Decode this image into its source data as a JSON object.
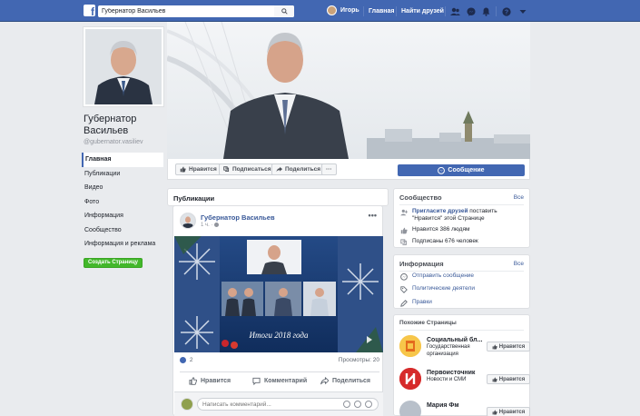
{
  "topbar": {
    "search_value": "Губернатор Васильев",
    "user_name": "Игорь",
    "home_link": "Главная",
    "find_friends_link": "Найти друзей"
  },
  "page": {
    "name": "Губернатор Васильев",
    "handle": "@gubernator.vasiliev"
  },
  "sidebar": {
    "items": [
      {
        "label": "Главная"
      },
      {
        "label": "Публикации"
      },
      {
        "label": "Видео"
      },
      {
        "label": "Фото"
      },
      {
        "label": "Информация"
      },
      {
        "label": "Сообщество"
      },
      {
        "label": "Информация и реклама"
      }
    ],
    "create_page_label": "Создать Страницу"
  },
  "actions": {
    "like_label": "Нравится",
    "follow_label": "Подписаться",
    "share_label": "Поделиться",
    "more_label": "···",
    "message_label": "Сообщение"
  },
  "publications": {
    "title": "Публикации",
    "post": {
      "author": "Губернатор Васильев",
      "time": "1 ч. ·",
      "more": "•••",
      "image_caption": "Итоги 2018 года",
      "likes_count": "2",
      "views": "Просмотры: 20",
      "like_label": "Нравится",
      "comment_label": "Комментарий",
      "share_label": "Поделиться",
      "comment_placeholder": "Написать комментарий..."
    }
  },
  "community": {
    "title": "Сообщество",
    "all_label": "Все",
    "invite_link": "Пригласите друзей",
    "invite_rest": " поставить \"Нравится\" этой Странице",
    "likes_text": "Нравится 386 людям",
    "followers_text": "Подписаны 676 человек"
  },
  "info": {
    "title": "Информация",
    "all_label": "Все",
    "send_message": "Отправить сообщение",
    "category": "Политические деятели",
    "edit": "Правки"
  },
  "similar": {
    "title": "Похожие Страницы",
    "items": [
      {
        "name": "Социальный бл...",
        "category": "Государственная организация",
        "button": "Нравится"
      },
      {
        "name": "Первоисточник",
        "category": "Новости и СМИ",
        "button": "Нравится"
      },
      {
        "name": "Мария Фм",
        "category": "",
        "button": "Нравится"
      }
    ]
  },
  "colors": {
    "brand": "#4267b2",
    "link": "#385898",
    "create_button": "#42b72a"
  }
}
